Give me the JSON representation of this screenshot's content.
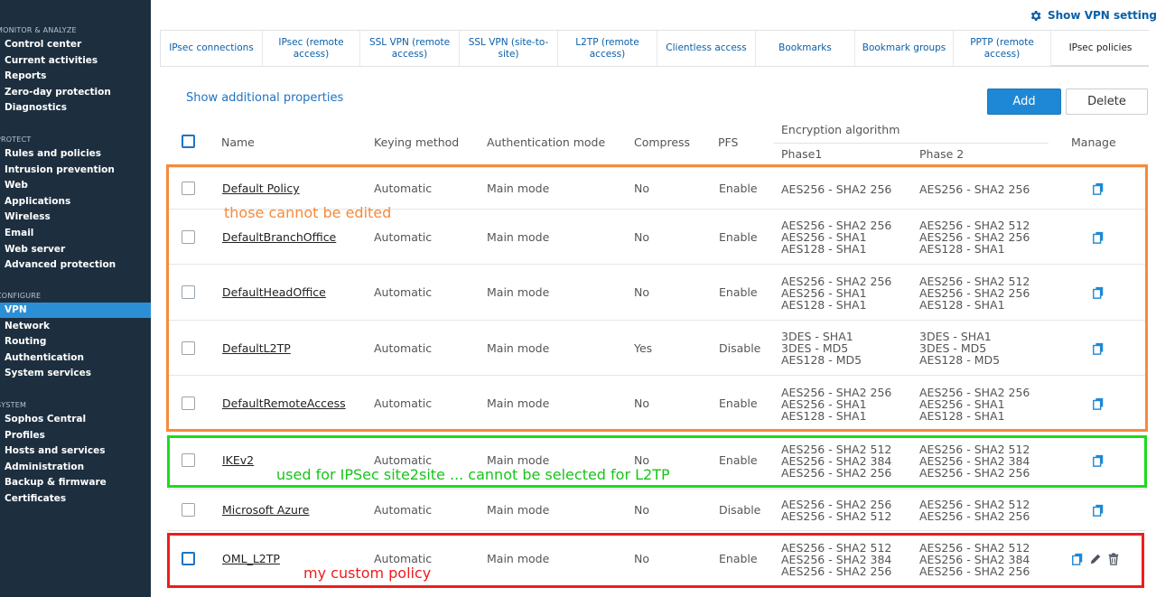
{
  "sidebar": {
    "sections": [
      {
        "label": "MONITOR & ANALYZE",
        "items": [
          "Control center",
          "Current activities",
          "Reports",
          "Zero-day protection",
          "Diagnostics"
        ]
      },
      {
        "label": "PROTECT",
        "items": [
          "Rules and policies",
          "Intrusion prevention",
          "Web",
          "Applications",
          "Wireless",
          "Email",
          "Web server",
          "Advanced protection"
        ]
      },
      {
        "label": "CONFIGURE",
        "items": [
          "VPN",
          "Network",
          "Routing",
          "Authentication",
          "System services"
        ]
      },
      {
        "label": "SYSTEM",
        "items": [
          "Sophos Central",
          "Profiles",
          "Hosts and services",
          "Administration",
          "Backup & firmware",
          "Certificates"
        ]
      }
    ],
    "active_item": "VPN"
  },
  "top": {
    "show_vpn_settings": "Show VPN settings"
  },
  "tabs": [
    {
      "label": "IPsec connections",
      "width": 113
    },
    {
      "label": "IPsec (remote access)",
      "width": 108
    },
    {
      "label": "SSL VPN (remote access)",
      "width": 110
    },
    {
      "label": "SSL VPN (site-to-site)",
      "width": 109
    },
    {
      "label": "L2TP (remote access)",
      "width": 110
    },
    {
      "label": "Clientless access",
      "width": 109
    },
    {
      "label": "Bookmarks",
      "width": 110
    },
    {
      "label": "Bookmark groups",
      "width": 109
    },
    {
      "label": "PPTP (remote access)",
      "width": 108
    },
    {
      "label": "IPsec policies",
      "width": 109
    }
  ],
  "toolbar": {
    "show_additional_properties": "Show additional properties",
    "add_label": "Add",
    "delete_label": "Delete"
  },
  "table": {
    "headers": {
      "name": "Name",
      "keying_method": "Keying method",
      "authentication_mode": "Authentication mode",
      "compress": "Compress",
      "pfs": "PFS",
      "encryption_algorithm": "Encryption algorithm",
      "phase1": "Phase1",
      "phase2": "Phase 2",
      "manage": "Manage"
    },
    "rows": [
      {
        "name": "Default Policy",
        "keying": "Automatic",
        "auth": "Main mode",
        "compress": "No",
        "pfs": "Enable",
        "phase1": [
          "AES256 - SHA2 256"
        ],
        "phase2": [
          "AES256 - SHA2 256"
        ],
        "editable": false
      },
      {
        "name": "DefaultBranchOffice",
        "keying": "Automatic",
        "auth": "Main mode",
        "compress": "No",
        "pfs": "Enable",
        "phase1": [
          "AES256 - SHA2 256",
          "AES256 - SHA1",
          "AES128 - SHA1"
        ],
        "phase2": [
          "AES256 - SHA2 512",
          "AES256 - SHA2 256",
          "AES128 - SHA1"
        ],
        "editable": false
      },
      {
        "name": "DefaultHeadOffice",
        "keying": "Automatic",
        "auth": "Main mode",
        "compress": "No",
        "pfs": "Enable",
        "phase1": [
          "AES256 - SHA2 256",
          "AES256 - SHA1",
          "AES128 - SHA1"
        ],
        "phase2": [
          "AES256 - SHA2 512",
          "AES256 - SHA2 256",
          "AES128 - SHA1"
        ],
        "editable": false
      },
      {
        "name": "DefaultL2TP",
        "keying": "Automatic",
        "auth": "Main mode",
        "compress": "Yes",
        "pfs": "Disable",
        "phase1": [
          "3DES - SHA1",
          "3DES - MD5",
          "AES128 - MD5"
        ],
        "phase2": [
          "3DES - SHA1",
          "3DES - MD5",
          "AES128 - MD5"
        ],
        "editable": false
      },
      {
        "name": "DefaultRemoteAccess",
        "keying": "Automatic",
        "auth": "Main mode",
        "compress": "No",
        "pfs": "Enable",
        "phase1": [
          "AES256 - SHA2 256",
          "AES256 - SHA1",
          "AES128 - SHA1"
        ],
        "phase2": [
          "AES256 - SHA2 256",
          "AES256 - SHA1",
          "AES128 - SHA1"
        ],
        "editable": false
      },
      {
        "name": "IKEv2",
        "keying": "Automatic",
        "auth": "Main mode",
        "compress": "No",
        "pfs": "Enable",
        "phase1": [
          "AES256 - SHA2 512",
          "AES256 - SHA2 384",
          "AES256 - SHA2 256"
        ],
        "phase2": [
          "AES256 - SHA2 512",
          "AES256 - SHA2 384",
          "AES256 - SHA2 256"
        ],
        "editable": false
      },
      {
        "name": "Microsoft Azure",
        "keying": "Automatic",
        "auth": "Main mode",
        "compress": "No",
        "pfs": "Disable",
        "phase1": [
          "AES256 - SHA2 256",
          "AES256 - SHA2 512"
        ],
        "phase2": [
          "AES256 - SHA2 512",
          "AES256 - SHA2 256"
        ],
        "editable": false
      },
      {
        "name": "OML_L2TP",
        "keying": "Automatic",
        "auth": "Main mode",
        "compress": "No",
        "pfs": "Enable",
        "phase1": [
          "AES256 - SHA2 512",
          "AES256 - SHA2 384",
          "AES256 - SHA2 256"
        ],
        "phase2": [
          "AES256 - SHA2 512",
          "AES256 - SHA2 384",
          "AES256 - SHA2 256"
        ],
        "editable": true
      }
    ]
  },
  "annotations": {
    "orange_note": "those cannot be edited",
    "green_note": "used for IPSec site2site ... cannot be selected for L2TP",
    "red_note": "my custom policy",
    "colors": {
      "orange": "#f58a3c",
      "green": "#1bdc1b",
      "red": "#ef1c1c"
    }
  },
  "colors": {
    "sidebar_bg": "#1d2f3f",
    "accent": "#1e88d6",
    "link": "#0b5fa8"
  }
}
